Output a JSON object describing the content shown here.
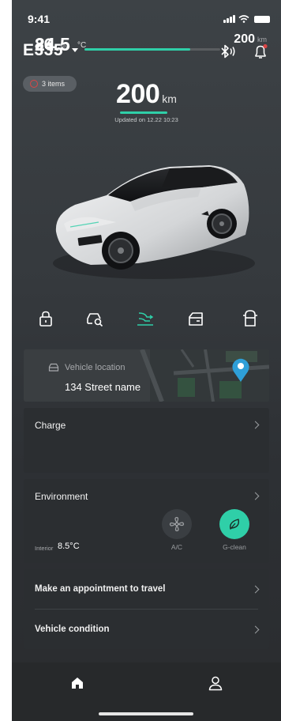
{
  "status_bar": {
    "time": "9:41"
  },
  "header": {
    "vehicle_name": "E335",
    "bluetooth_icon": "bluetooth-icon",
    "bell_icon": "bell-icon"
  },
  "alerts": {
    "label": "3 items"
  },
  "range": {
    "value": "200",
    "unit": "km",
    "updated": "Updated on 12.22 10:23"
  },
  "quick_actions": [
    {
      "name": "lock-icon"
    },
    {
      "name": "car-search-icon"
    },
    {
      "name": "fan-flow-icon"
    },
    {
      "name": "trunk-icon"
    },
    {
      "name": "door-icon"
    }
  ],
  "location": {
    "label": "Vehicle location",
    "street": "134 Street name"
  },
  "charge": {
    "title": "Charge",
    "percent": "86",
    "percent_symbol": "%",
    "range_value": "200",
    "range_unit": "km",
    "fill_fraction": 0.78
  },
  "environment": {
    "title": "Environment",
    "temperature": "24.5",
    "temperature_unit": "°C",
    "interior_label": "Interior",
    "interior_value": "8.5°C",
    "ac_label": "A/C",
    "gclean_label": "G-clean"
  },
  "menu": {
    "appointment": "Make an appointment to travel",
    "condition": "Vehicle condition"
  },
  "tabs": [
    {
      "name": "home-icon"
    },
    {
      "name": "profile-icon"
    }
  ],
  "colors": {
    "accent": "#2fcfa8",
    "alert": "#d94545",
    "map_pin": "#2e9fd8"
  }
}
